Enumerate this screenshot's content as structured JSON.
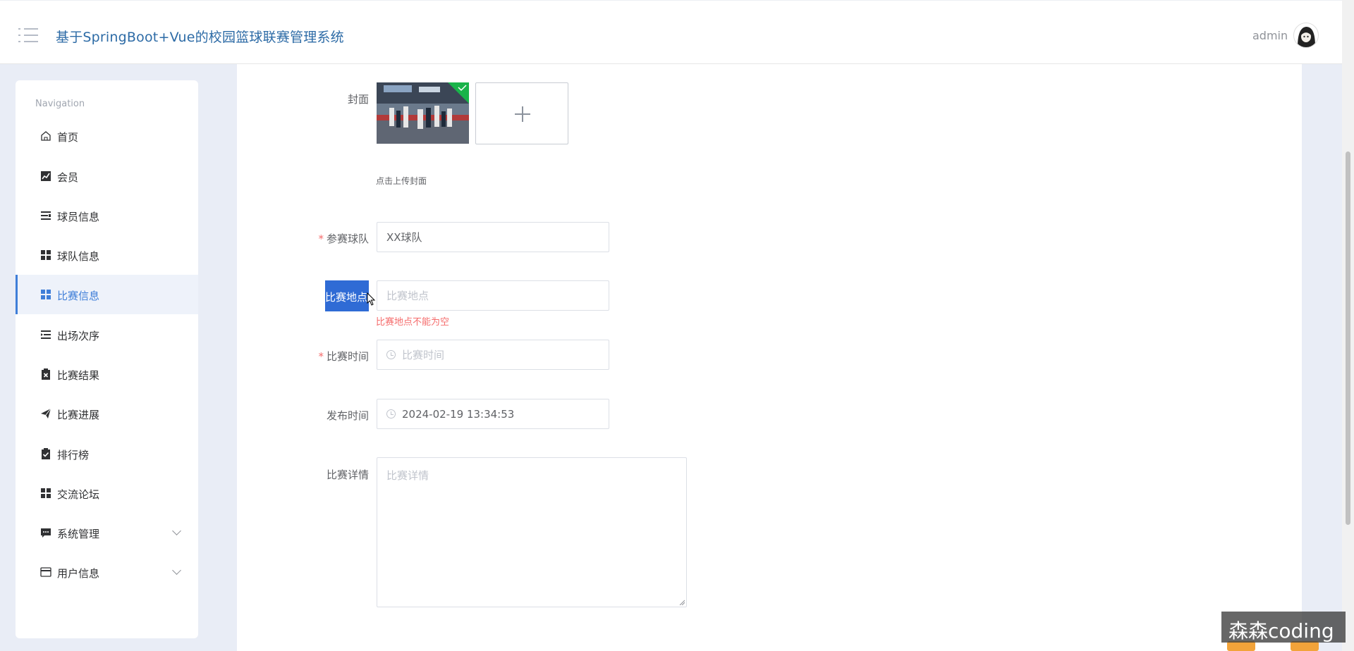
{
  "header": {
    "title": "基于SpringBoot+Vue的校园篮球联赛管理系统",
    "user": "admin"
  },
  "sidebar": {
    "heading": "Navigation",
    "items": [
      {
        "label": "首页",
        "icon": "home-icon"
      },
      {
        "label": "会员",
        "icon": "chart-icon"
      },
      {
        "label": "球员信息",
        "icon": "list-icon"
      },
      {
        "label": "球队信息",
        "icon": "grid-icon"
      },
      {
        "label": "比赛信息",
        "icon": "grid-icon",
        "active": true
      },
      {
        "label": "出场次序",
        "icon": "indent-icon"
      },
      {
        "label": "比赛结果",
        "icon": "clipboard-x-icon"
      },
      {
        "label": "比赛进展",
        "icon": "send-icon"
      },
      {
        "label": "排行榜",
        "icon": "clipboard-check-icon"
      },
      {
        "label": "交流论坛",
        "icon": "grid-icon"
      },
      {
        "label": "系统管理",
        "icon": "chat-icon",
        "expandable": true
      },
      {
        "label": "用户信息",
        "icon": "card-icon",
        "expandable": true
      }
    ]
  },
  "form": {
    "cover": {
      "label": "封面",
      "hint": "点击上传封面"
    },
    "team": {
      "label": "参赛球队",
      "value": "XX球队",
      "required": true
    },
    "venue": {
      "label": "比赛地点",
      "placeholder": "比赛地点",
      "required": true,
      "error": "比赛地点不能为空"
    },
    "time": {
      "label": "比赛时间",
      "placeholder": "比赛时间",
      "required": true
    },
    "publish": {
      "label": "发布时间",
      "value": "2024-02-19 13:34:53"
    },
    "details": {
      "label": "比赛详情",
      "placeholder": "比赛详情"
    }
  },
  "watermark": "森森coding",
  "colors": {
    "accent": "#3f7ed8",
    "title": "#2d6ba6",
    "error": "#f56c6c",
    "selection": "#2f6bd5"
  }
}
